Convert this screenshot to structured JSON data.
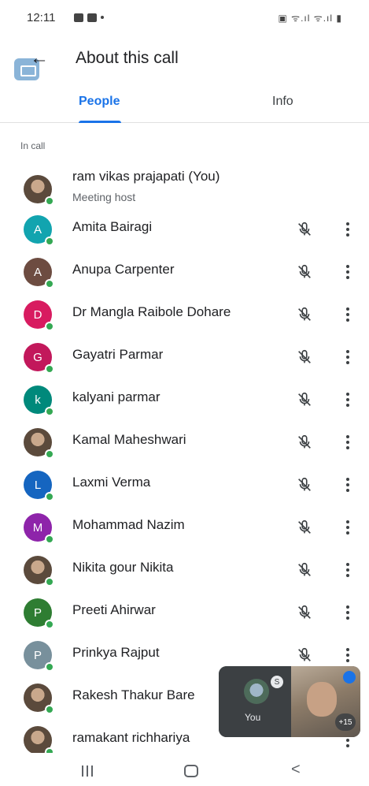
{
  "status_bar": {
    "time": "12:11",
    "right_indicators": "▣ ᯤ.ıl ᯤ.ıl ▮"
  },
  "header": {
    "title": "About this call",
    "back_icon": "arrow-left-icon",
    "pip_icon": "pip-window-icon"
  },
  "tabs": [
    {
      "label": "People",
      "active": true
    },
    {
      "label": "Info",
      "active": false
    }
  ],
  "colors": {
    "accent": "#1a73e8",
    "online": "#34a853"
  },
  "section_label": "In call",
  "participants": [
    {
      "name": "ram vikas prajapati (You)",
      "subtitle": "Meeting host",
      "initial": "",
      "avatar_color": "",
      "photo": true,
      "muted": false,
      "menu": false
    },
    {
      "name": "Amita Bairagi",
      "subtitle": "",
      "initial": "A",
      "avatar_color": "#12a4af",
      "photo": false,
      "muted": true,
      "menu": true
    },
    {
      "name": "Anupa Carpenter",
      "subtitle": "",
      "initial": "A",
      "avatar_color": "#6d4c41",
      "photo": false,
      "muted": true,
      "menu": true
    },
    {
      "name": "Dr Mangla Raibole Dohare",
      "subtitle": "",
      "initial": "D",
      "avatar_color": "#d81b60",
      "photo": false,
      "muted": true,
      "menu": true
    },
    {
      "name": "Gayatri Parmar",
      "subtitle": "",
      "initial": "G",
      "avatar_color": "#c2185b",
      "photo": false,
      "muted": true,
      "menu": true
    },
    {
      "name": "kalyani parmar",
      "subtitle": "",
      "initial": "k",
      "avatar_color": "#00897b",
      "photo": false,
      "muted": true,
      "menu": true
    },
    {
      "name": "Kamal Maheshwari",
      "subtitle": "",
      "initial": "",
      "avatar_color": "",
      "photo": true,
      "muted": true,
      "menu": true
    },
    {
      "name": "Laxmi Verma",
      "subtitle": "",
      "initial": "L",
      "avatar_color": "#1565c0",
      "photo": false,
      "muted": true,
      "menu": true
    },
    {
      "name": "Mohammad Nazim",
      "subtitle": "",
      "initial": "M",
      "avatar_color": "#8e24aa",
      "photo": false,
      "muted": true,
      "menu": true
    },
    {
      "name": "Nikita gour Nikita",
      "subtitle": "",
      "initial": "",
      "avatar_color": "",
      "photo": true,
      "muted": true,
      "menu": true
    },
    {
      "name": "Preeti Ahirwar",
      "subtitle": "",
      "initial": "P",
      "avatar_color": "#2e7d32",
      "photo": false,
      "muted": true,
      "menu": true
    },
    {
      "name": "Prinkya Rajput",
      "subtitle": "",
      "initial": "P",
      "avatar_color": "#78909c",
      "photo": false,
      "muted": true,
      "menu": true
    },
    {
      "name": "Rakesh Thakur Bare",
      "subtitle": "",
      "initial": "",
      "avatar_color": "",
      "photo": true,
      "muted": false,
      "menu": false
    },
    {
      "name": "ramakant richhariya",
      "subtitle": "",
      "initial": "",
      "avatar_color": "",
      "photo": true,
      "muted": false,
      "menu": true
    }
  ],
  "floating_tile": {
    "self_label": "You",
    "self_badge": "S",
    "more_count": "+15"
  },
  "nav_bar": {
    "recents_icon": "recents-icon",
    "home_icon": "home-icon",
    "back_icon": "back-chevron-icon",
    "back_glyph": "<"
  }
}
